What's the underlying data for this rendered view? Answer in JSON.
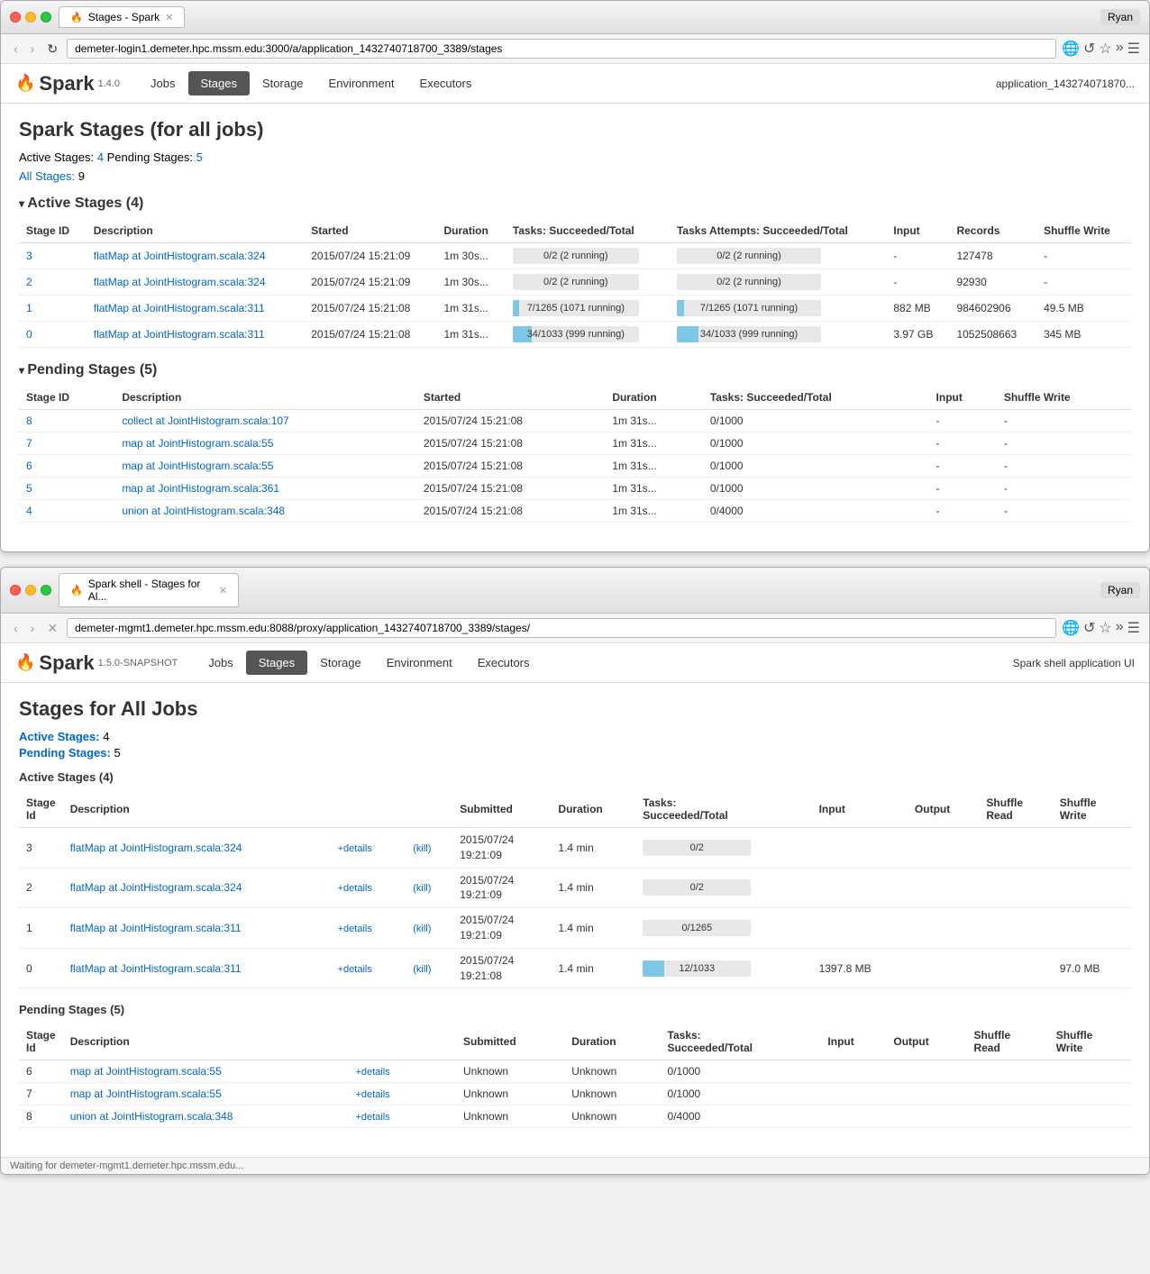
{
  "window1": {
    "tab_label": "Stages - Spark",
    "user": "Ryan",
    "url": "demeter-login1.demeter.hpc.mssm.edu:3000/a/application_1432740718700_3389/stages",
    "nav": {
      "jobs": "Jobs",
      "stages": "Stages",
      "storage": "Storage",
      "environment": "Environment",
      "executors": "Executors",
      "active_tab": "Stages"
    },
    "spark_version": "1.4.0",
    "app_id": "application_143274071870...",
    "page_title": "Spark Stages (for all jobs)",
    "summary": {
      "active_label": "Active Stages:",
      "active_count": "4",
      "pending_label": "Pending Stages:",
      "pending_count": "5",
      "all_label": "All Stages:",
      "all_count": "9"
    },
    "active_section_title": "Active Stages (4)",
    "active_table": {
      "headers": [
        "Stage ID",
        "Description",
        "Started",
        "Duration",
        "Tasks: Succeeded/Total",
        "Tasks Attempts: Succeeded/Total",
        "Input",
        "Records",
        "Shuffle Write"
      ],
      "rows": [
        {
          "id": "3",
          "description": "flatMap at JointHistogram.scala:324",
          "started": "2015/07/24 15:21:09",
          "duration": "1m 30s...",
          "tasks_progress": "0/2 (2 running)",
          "tasks_pct": 0,
          "attempts_progress": "0/2 (2 running)",
          "attempts_pct": 0,
          "input": "-",
          "records": "127478",
          "shuffle_write": "-"
        },
        {
          "id": "2",
          "description": "flatMap at JointHistogram.scala:324",
          "started": "2015/07/24 15:21:09",
          "duration": "1m 30s...",
          "tasks_progress": "0/2 (2 running)",
          "tasks_pct": 0,
          "attempts_progress": "0/2 (2 running)",
          "attempts_pct": 0,
          "input": "-",
          "records": "92930",
          "shuffle_write": "-"
        },
        {
          "id": "1",
          "description": "flatMap at JointHistogram.scala:311",
          "started": "2015/07/24 15:21:08",
          "duration": "1m 31s...",
          "tasks_progress": "7/1265 (1071 running)",
          "tasks_pct": 1,
          "attempts_progress": "7/1265 (1071 running)",
          "attempts_pct": 1,
          "input": "882 MB",
          "records": "984602906",
          "shuffle_write": "49.5 MB"
        },
        {
          "id": "0",
          "description": "flatMap at JointHistogram.scala:311",
          "started": "2015/07/24 15:21:08",
          "duration": "1m 31s...",
          "tasks_progress": "34/1033 (999 running)",
          "tasks_pct": 3,
          "attempts_progress": "34/1033 (999 running)",
          "attempts_pct": 3,
          "input": "3.97 GB",
          "records": "1052508663",
          "shuffle_write": "345 MB"
        }
      ]
    },
    "pending_section_title": "Pending Stages (5)",
    "pending_table": {
      "headers": [
        "Stage ID",
        "Description",
        "Started",
        "Duration",
        "Tasks: Succeeded/Total",
        "Input",
        "Shuffle Write"
      ],
      "rows": [
        {
          "id": "8",
          "description": "collect at JointHistogram.scala:107",
          "started": "2015/07/24 15:21:08",
          "duration": "1m 31s...",
          "tasks": "0/1000",
          "input": "-",
          "shuffle_write": "-"
        },
        {
          "id": "7",
          "description": "map at JointHistogram.scala:55",
          "started": "2015/07/24 15:21:08",
          "duration": "1m 31s...",
          "tasks": "0/1000",
          "input": "-",
          "shuffle_write": "-"
        },
        {
          "id": "6",
          "description": "map at JointHistogram.scala:55",
          "started": "2015/07/24 15:21:08",
          "duration": "1m 31s...",
          "tasks": "0/1000",
          "input": "-",
          "shuffle_write": "-"
        },
        {
          "id": "5",
          "description": "map at JointHistogram.scala:361",
          "started": "2015/07/24 15:21:08",
          "duration": "1m 31s...",
          "tasks": "0/1000",
          "input": "-",
          "shuffle_write": "-"
        },
        {
          "id": "4",
          "description": "union at JointHistogram.scala:348",
          "started": "2015/07/24 15:21:08",
          "duration": "1m 31s...",
          "tasks": "0/4000",
          "input": "-",
          "shuffle_write": "-"
        }
      ]
    }
  },
  "window2": {
    "tab_label": "Spark shell - Stages for Al...",
    "user": "Ryan",
    "url": "demeter-mgmt1.demeter.hpc.mssm.edu:8088/proxy/application_1432740718700_3389/stages/",
    "nav": {
      "jobs": "Jobs",
      "stages": "Stages",
      "storage": "Storage",
      "environment": "Environment",
      "executors": "Executors",
      "active_tab": "Stages"
    },
    "spark_version": "1.5.0-SNAPSHOT",
    "app_id": "Spark shell application UI",
    "page_title": "Stages for All Jobs",
    "summary": {
      "active_label": "Active Stages:",
      "active_count": "4",
      "pending_label": "Pending Stages:",
      "pending_count": "5"
    },
    "active_section_title": "Active Stages (4)",
    "active_table": {
      "headers": [
        "Stage Id",
        "Description",
        "",
        "",
        "Submitted",
        "Duration",
        "Tasks: Succeeded/Total",
        "Input",
        "Output",
        "Shuffle Read",
        "Shuffle Write"
      ],
      "rows": [
        {
          "id": "3",
          "description": "flatMap at JointHistogram.scala:324",
          "submitted": "2015/07/24\n19:21:09",
          "duration": "1.4 min",
          "tasks_progress": "0/2",
          "tasks_pct": 0,
          "input": "",
          "output": "",
          "shuffle_read": "",
          "shuffle_write": ""
        },
        {
          "id": "2",
          "description": "flatMap at JointHistogram.scala:324",
          "submitted": "2015/07/24\n19:21:09",
          "duration": "1.4 min",
          "tasks_progress": "0/2",
          "tasks_pct": 0,
          "input": "",
          "output": "",
          "shuffle_read": "",
          "shuffle_write": ""
        },
        {
          "id": "1",
          "description": "flatMap at JointHistogram.scala:311",
          "submitted": "2015/07/24\n19:21:09",
          "duration": "1.4 min",
          "tasks_progress": "0/1265",
          "tasks_pct": 0,
          "input": "",
          "output": "",
          "shuffle_read": "",
          "shuffle_write": ""
        },
        {
          "id": "0",
          "description": "flatMap at JointHistogram.scala:311",
          "submitted": "2015/07/24\n19:21:08",
          "duration": "1.4 min",
          "tasks_progress": "12/1033",
          "tasks_pct": 1,
          "input": "1397.8 MB",
          "output": "",
          "shuffle_read": "",
          "shuffle_write": "97.0 MB"
        }
      ]
    },
    "pending_section_title": "Pending Stages (5)",
    "pending_table": {
      "headers": [
        "Stage Id",
        "Description",
        "",
        "",
        "Submitted",
        "Duration",
        "Tasks: Succeeded/Total",
        "Input",
        "Output",
        "Shuffle Read",
        "Shuffle Write"
      ],
      "rows": [
        {
          "id": "6",
          "description": "map at JointHistogram.scala:55",
          "submitted": "Unknown",
          "duration": "Unknown",
          "tasks": "0/1000"
        },
        {
          "id": "7",
          "description": "map at JointHistogram.scala:55",
          "submitted": "Unknown",
          "duration": "Unknown",
          "tasks": "0/1000"
        },
        {
          "id": "8",
          "description": "union at JointHistogram.scala:348",
          "submitted": "Unknown",
          "duration": "Unknown",
          "tasks": "0/4000"
        }
      ]
    },
    "status_bar": "Waiting for demeter-mgmt1.demeter.hpc.mssm.edu..."
  }
}
